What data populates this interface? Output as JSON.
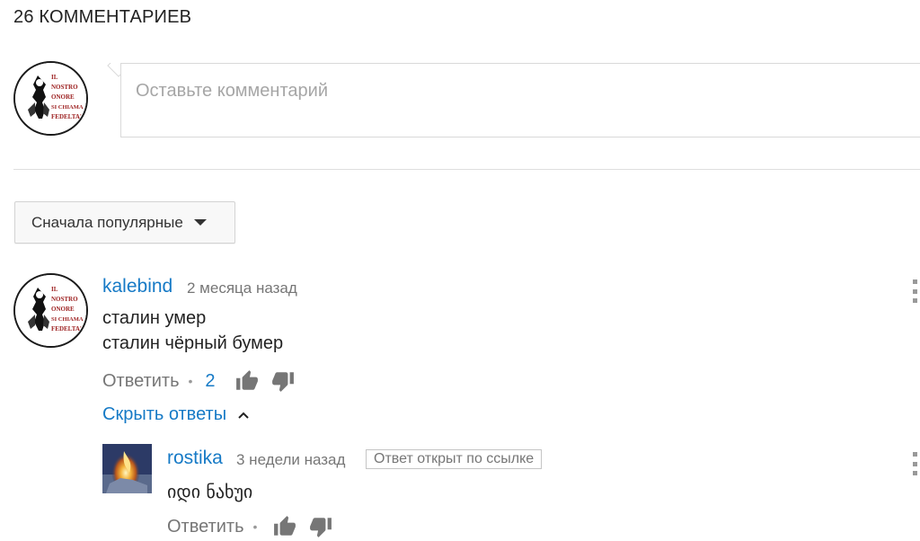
{
  "header": {
    "comment_count_title": "26 КОММЕНТАРИЕВ"
  },
  "composer": {
    "placeholder": "Оставьте комментарий"
  },
  "sort": {
    "label": "Сначала популярные"
  },
  "comments": [
    {
      "author": "kalebind",
      "time": "2 месяца назад",
      "lines": [
        "сталин умер",
        "сталин чёрный бумер"
      ],
      "reply_label": "Ответить",
      "likes": "2",
      "hide_replies_label": "Скрыть ответы",
      "replies": [
        {
          "author": "rostika",
          "time": "3 недели назад",
          "badge": "Ответ открыт по ссылке",
          "text": "იდი ნახუი",
          "reply_label": "Ответить"
        }
      ]
    }
  ],
  "avatar_logo_text": [
    "IL",
    "NOSTRO",
    "ONORE",
    "SI CHIAMA",
    "FEDELTA'"
  ],
  "icons": {
    "like": "thumbs-up-icon",
    "dislike": "thumbs-down-icon",
    "more": "more-vert-icon",
    "caret": "caret-down-icon",
    "chevron": "chevron-up-icon"
  },
  "colors": {
    "link_blue": "#167ac6",
    "meta_gray": "#767676",
    "thumb_gray": "#767676"
  }
}
